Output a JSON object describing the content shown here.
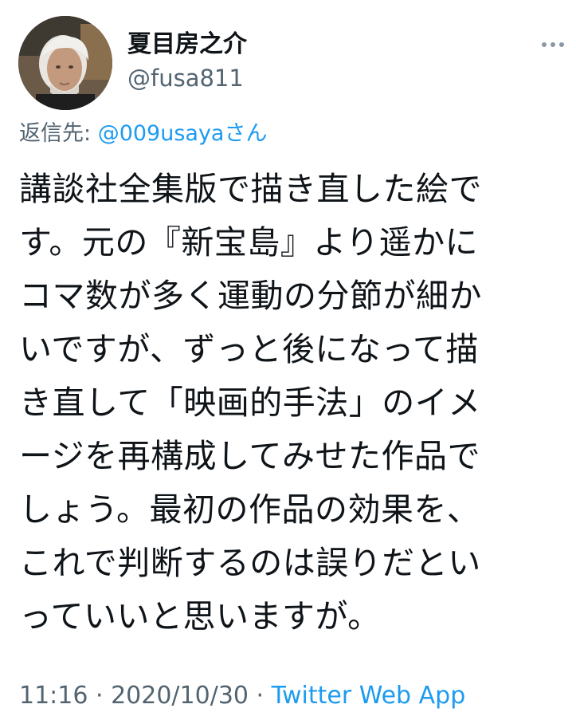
{
  "author": {
    "display_name": "夏目房之介",
    "handle": "@fusa811"
  },
  "reply": {
    "label": "返信先: ",
    "mention": "@009usayaさん"
  },
  "tweet": {
    "lines": [
      "講談社全集版で描き直した絵で",
      "す。元の『新宝島』より遥かに",
      "コマ数が多く運動の分節が細か",
      "いですが、ずっと後になって描",
      "き直して「映画的手法」のイメ",
      "ージを再構成してみせた作品で",
      "しょう。最初の作品の効果を、",
      "これで判断するのは誤りだとい",
      "っていいと思いますが。"
    ]
  },
  "meta": {
    "time": "11:16",
    "separator": " · ",
    "date": "2020/10/30",
    "source": "Twitter Web App"
  },
  "icons": {
    "more": "more-horizontal-icon",
    "avatar": "author-avatar-photo"
  },
  "colors": {
    "link": "#1d9bf0",
    "secondary_text": "#536471",
    "primary_text": "#0f1419"
  }
}
